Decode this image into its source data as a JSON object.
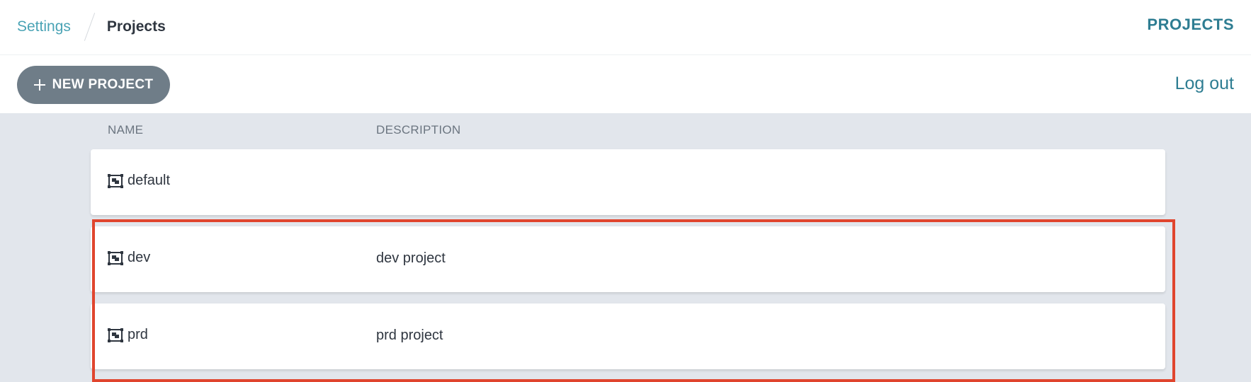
{
  "breadcrumb": {
    "parent": "Settings",
    "current": "Projects"
  },
  "header": {
    "title": "PROJECTS"
  },
  "toolbar": {
    "new_project_label": "NEW PROJECT",
    "logout_label": "Log out"
  },
  "table": {
    "columns": [
      "NAME",
      "DESCRIPTION"
    ],
    "rows": [
      {
        "name": "default",
        "description": ""
      },
      {
        "name": "dev",
        "description": "dev project"
      },
      {
        "name": "prd",
        "description": "prd project"
      }
    ]
  },
  "icons": {
    "project": "project-icon",
    "plus": "plus-icon"
  },
  "colors": {
    "accent": "#2e7d92",
    "link": "#4aa3b5",
    "button_bg": "#6f7d88",
    "content_bg": "#e2e6ec",
    "highlight": "#e0452e"
  }
}
